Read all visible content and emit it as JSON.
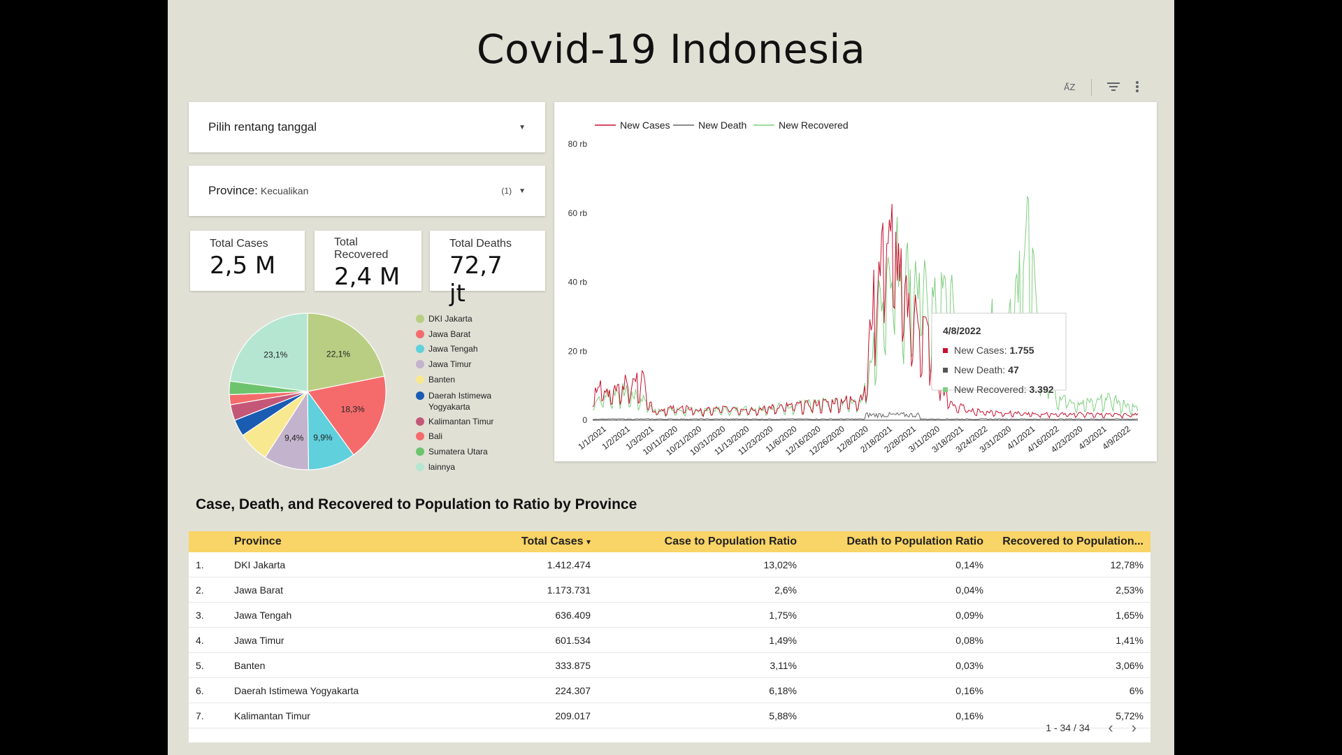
{
  "title": "Covid-19 Indonesia",
  "toolbar": {
    "sort_icon": "AZ",
    "filter_icon": "filter-icon",
    "more_icon": "more-vert-icon"
  },
  "date_control": {
    "label": "Pilih rentang tanggal"
  },
  "province_control": {
    "label": "Province:",
    "mode": "Kecualikan",
    "count": "(1)"
  },
  "kpis": {
    "total_cases": {
      "label": "Total Cases",
      "value": "2,5 M"
    },
    "total_recovered": {
      "label": "Total Recovered",
      "value": "2,4 M"
    },
    "total_deaths": {
      "label": "Total Deaths",
      "value": "72,7 jt"
    }
  },
  "pie": {
    "slices": [
      {
        "name": "DKI Jakarta",
        "value": 22.1,
        "label": "22,1%",
        "color": "#b9ce82"
      },
      {
        "name": "Jawa Barat",
        "value": 18.3,
        "label": "18,3%",
        "color": "#f56b6b"
      },
      {
        "name": "Jawa Tengah",
        "value": 9.9,
        "label": "9,9%",
        "color": "#5fd0dc"
      },
      {
        "name": "Jawa Timur",
        "value": 9.4,
        "label": "9,4%",
        "color": "#c3b3cc"
      },
      {
        "name": "Banten",
        "value": 6.5,
        "label": "",
        "color": "#f8e88f"
      },
      {
        "name": "Daerah Istimewa Yogyakarta",
        "value": 3.5,
        "label": "",
        "color": "#1a5cb2"
      },
      {
        "name": "Kalimantan Timur",
        "value": 3.3,
        "label": "",
        "color": "#c45778"
      },
      {
        "name": "Bali",
        "value": 2.1,
        "label": "",
        "color": "#f56b6b"
      },
      {
        "name": "Sumatera Utara",
        "value": 2.8,
        "label": "",
        "color": "#6dc46d"
      },
      {
        "name": "lainnya",
        "value": 23.1,
        "label": "23,1%",
        "color": "#b5e6d2"
      }
    ],
    "legend": [
      {
        "label": "DKI Jakarta",
        "color": "#b9ce82"
      },
      {
        "label": "Jawa Barat",
        "color": "#f56b6b"
      },
      {
        "label": "Jawa Tengah",
        "color": "#5fd0dc"
      },
      {
        "label": "Jawa Timur",
        "color": "#c3b3cc"
      },
      {
        "label": "Banten",
        "color": "#f8e88f"
      },
      {
        "label": "Daerah Istimewa Yogyakarta",
        "color": "#1a5cb2"
      },
      {
        "label": "Kalimantan Timur",
        "color": "#c45778"
      },
      {
        "label": "Bali",
        "color": "#f56b6b"
      },
      {
        "label": "Sumatera Utara",
        "color": "#6dc46d"
      },
      {
        "label": "lainnya",
        "color": "#b5e6d2"
      }
    ]
  },
  "chart_data": {
    "type": "line",
    "legend": [
      "New Cases",
      "New Death",
      "New Recovered"
    ],
    "colors": {
      "New Cases": "#c8102e",
      "New Death": "#666666",
      "New Recovered": "#7fce7f"
    },
    "ylim": [
      0,
      80000
    ],
    "y_ticks": [
      "0",
      "20 rb",
      "40 rb",
      "60 rb",
      "80 rb"
    ],
    "x_ticks": [
      "1/1/2021",
      "1/2/2021",
      "1/3/2021",
      "10/11/2020",
      "10/21/2020",
      "10/31/2020",
      "11/13/2020",
      "11/23/2020",
      "11/6/2020",
      "12/16/2020",
      "12/26/2020",
      "12/8/2020",
      "2/18/2021",
      "2/28/2021",
      "3/11/2020",
      "3/18/2021",
      "3/24/2022",
      "3/31/2020",
      "4/1/2021",
      "4/16/2022",
      "4/23/2020",
      "4/3/2021",
      "4/9/2022"
    ],
    "series_profile_new_cases": [
      [
        0,
        6000
      ],
      [
        0.01,
        11000
      ],
      [
        0.03,
        8000
      ],
      [
        0.05,
        12000
      ],
      [
        0.07,
        11000
      ],
      [
        0.09,
        14000
      ],
      [
        0.1,
        9000
      ],
      [
        0.11,
        3000
      ],
      [
        0.16,
        4000
      ],
      [
        0.2,
        3000
      ],
      [
        0.25,
        4000
      ],
      [
        0.3,
        3500
      ],
      [
        0.35,
        4500
      ],
      [
        0.4,
        5000
      ],
      [
        0.45,
        6000
      ],
      [
        0.49,
        7000
      ],
      [
        0.5,
        9000
      ],
      [
        0.51,
        30000
      ],
      [
        0.52,
        45000
      ],
      [
        0.53,
        55000
      ],
      [
        0.54,
        63000
      ],
      [
        0.55,
        58000
      ],
      [
        0.56,
        50000
      ],
      [
        0.57,
        40000
      ],
      [
        0.58,
        35000
      ],
      [
        0.6,
        32000
      ],
      [
        0.62,
        25000
      ],
      [
        0.63,
        20000
      ],
      [
        0.64,
        10000
      ],
      [
        0.66,
        5000
      ],
      [
        0.7,
        3000
      ],
      [
        0.75,
        2500
      ],
      [
        0.8,
        2000
      ],
      [
        0.85,
        2000
      ],
      [
        0.9,
        2000
      ],
      [
        0.95,
        1800
      ],
      [
        1,
        1755
      ]
    ],
    "series_profile_new_recovered": [
      [
        0,
        6000
      ],
      [
        0.05,
        9000
      ],
      [
        0.1,
        6000
      ],
      [
        0.11,
        3000
      ],
      [
        0.2,
        3000
      ],
      [
        0.3,
        3500
      ],
      [
        0.4,
        5000
      ],
      [
        0.49,
        6000
      ],
      [
        0.51,
        15000
      ],
      [
        0.53,
        40000
      ],
      [
        0.55,
        52000
      ],
      [
        0.57,
        45000
      ],
      [
        0.6,
        40000
      ],
      [
        0.63,
        33000
      ],
      [
        0.65,
        38000
      ],
      [
        0.68,
        25000
      ],
      [
        0.7,
        20000
      ],
      [
        0.73,
        30000
      ],
      [
        0.75,
        18000
      ],
      [
        0.78,
        45000
      ],
      [
        0.8,
        54000
      ],
      [
        0.82,
        20000
      ],
      [
        0.85,
        8000
      ],
      [
        0.9,
        5000
      ],
      [
        0.95,
        7000
      ],
      [
        1,
        3392
      ]
    ],
    "tooltip": {
      "date": "4/8/2022",
      "rows": [
        {
          "label": "New Cases:",
          "value": "1.755",
          "color": "#c8102e"
        },
        {
          "label": "New Death:",
          "value": "47",
          "color": "#555555"
        },
        {
          "label": "New Recovered:",
          "value": "3.392",
          "color": "#7fce7f"
        }
      ]
    }
  },
  "table": {
    "title": "Case, Death, and Recovered to Population to Ratio by Province",
    "headers": [
      "Province",
      "Total Cases",
      "Case to Population Ratio",
      "Death to Population Ratio",
      "Recovered to Population..."
    ],
    "sort_indicator": "▾",
    "rows": [
      [
        "1.",
        "DKI Jakarta",
        "1.412.474",
        "13,02%",
        "0,14%",
        "12,78%"
      ],
      [
        "2.",
        "Jawa Barat",
        "1.173.731",
        "2,6%",
        "0,04%",
        "2,53%"
      ],
      [
        "3.",
        "Jawa Tengah",
        "636.409",
        "1,75%",
        "0,09%",
        "1,65%"
      ],
      [
        "4.",
        "Jawa Timur",
        "601.534",
        "1,49%",
        "0,08%",
        "1,41%"
      ],
      [
        "5.",
        "Banten",
        "333.875",
        "3,11%",
        "0,03%",
        "3,06%"
      ],
      [
        "6.",
        "Daerah Istimewa Yogyakarta",
        "224.307",
        "6,18%",
        "0,16%",
        "6%"
      ],
      [
        "7.",
        "Kalimantan Timur",
        "209.017",
        "5,88%",
        "0,16%",
        "5,72%"
      ]
    ],
    "pagination": "1 - 34 / 34"
  }
}
